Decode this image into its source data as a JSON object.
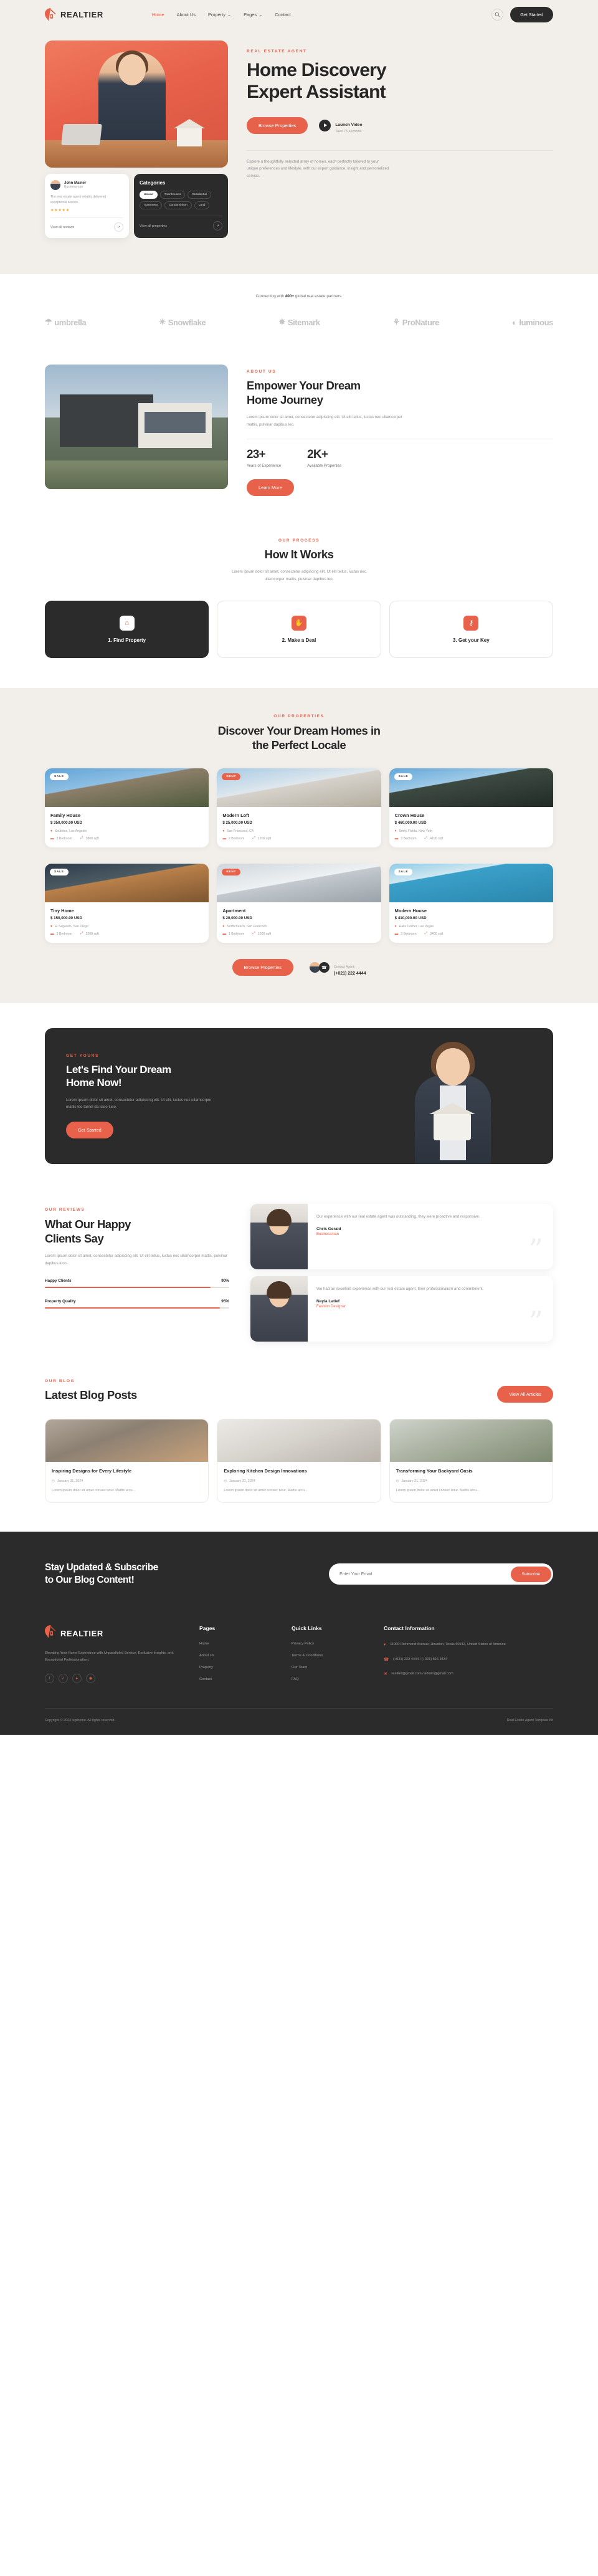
{
  "brand": {
    "name": "REALTIER",
    "accent": "#e8614a",
    "dark": "#2b2b2b"
  },
  "header": {
    "nav": [
      {
        "label": "Home",
        "active": true
      },
      {
        "label": "About Us",
        "active": false
      },
      {
        "label": "Property",
        "caret": "⌄",
        "active": false
      },
      {
        "label": "Pages",
        "caret": "⌄",
        "active": false
      },
      {
        "label": "Contact",
        "active": false
      }
    ],
    "search_icon": "⌕",
    "cta": "Get Started"
  },
  "hero": {
    "eyebrow": "REAL ESTATE AGENT",
    "title_line1": "Home Discovery",
    "title_line2": "Expert Assistant",
    "primary_btn": "Browse Properties",
    "video_title": "Launch Video",
    "video_sub": "Take 75 seconds",
    "description": "Explore a thoughtfully selected array of homes, each perfectly tailored to your unique preferences and lifestyle, with our expert guidance, insight and personalized service.",
    "review": {
      "name": "John Mainer",
      "role": "Businessman",
      "text": "The real estate agent reliably delivered exceptional service.",
      "stars": "★★★★★",
      "link": "View all reviews",
      "arrow": "↗"
    },
    "categories": {
      "title": "Categories",
      "chips": [
        "House",
        "Townhouses",
        "Residential",
        "Apartment",
        "Condominium",
        "Land"
      ],
      "active_chip": "House",
      "link": "View all properties",
      "arrow": "↗"
    }
  },
  "partners": {
    "caption_pre": "Connecting with ",
    "caption_bold": "400+",
    "caption_post": " global real estate partners.",
    "logos": [
      {
        "name": "umbrella",
        "glyph": "☂"
      },
      {
        "name": "Snowflake",
        "glyph": "✳"
      },
      {
        "name": "Sitemark",
        "glyph": "✵"
      },
      {
        "name": "ProNature",
        "glyph": "⚘"
      },
      {
        "name": "luminous",
        "glyph": "◐"
      }
    ]
  },
  "about": {
    "eyebrow": "ABOUT US",
    "title_line1": "Empower Your Dream",
    "title_line2": "Home Journey",
    "paragraph": "Lorem ipsum dolor sit amet, consectetur adipiscing elit. Ut elit tellus, luctus nec ullamcorper mattis, pulvinar dapibus leo.",
    "stats": [
      {
        "number": "23+",
        "label": "Years of Experience"
      },
      {
        "number": "2K+",
        "label": "Available Properties"
      }
    ],
    "btn": "Learn More"
  },
  "process": {
    "eyebrow": "OUR PROCESS",
    "title": "How It Works",
    "subtitle": "Lorem ipsum dolor sit amet, consectetur adipiscing elit. Ut elit tellus, luctus nec ullamcorper mattis, pulvinar dapibus leo.",
    "steps": [
      {
        "label": "1. Find Property",
        "icon": "⌂",
        "icon_name": "house-icon",
        "active": true
      },
      {
        "label": "2. Make a Deal",
        "icon": "✋",
        "icon_name": "handshake-icon",
        "active": false
      },
      {
        "label": "3. Get your Key",
        "icon": "⚷",
        "icon_name": "key-icon",
        "active": false
      }
    ]
  },
  "properties": {
    "eyebrow": "OUR PROPERTIES",
    "title_line1": "Discover Your Dream Homes in",
    "title_line2": "the Perfect Locale",
    "pin_icon": "▾",
    "bed_icon": "▬",
    "area_icon": "⤢",
    "items": [
      {
        "badge": "SALE",
        "badge_type": "sale",
        "name": "Family House",
        "price": "$ 350,000.00 USD",
        "location": "Southlea, Los Angeles",
        "bedrooms": "3 Bedroom",
        "area": "3800 sqft"
      },
      {
        "badge": "RENT",
        "badge_type": "rent",
        "name": "Modern Loft",
        "price": "$ 25,000.00 USD",
        "location": "San Francisco, CA",
        "bedrooms": "2 Bedroom",
        "area": "1200 sqft"
      },
      {
        "badge": "SALE",
        "badge_type": "sale",
        "name": "Crown House",
        "price": "$ 460,000.00 USD",
        "location": "Smity Fielda, New York",
        "bedrooms": "3 Bedroom",
        "area": "4100 sqft"
      },
      {
        "badge": "SALE",
        "badge_type": "sale",
        "name": "Tiny Home",
        "price": "$ 150,000.00 USD",
        "location": "El Segundo, San Diego",
        "bedrooms": "3 Bedroom",
        "area": "2200 sqft"
      },
      {
        "badge": "RENT",
        "badge_type": "rent",
        "name": "Apartment",
        "price": "$ 20,000.00 USD",
        "location": "North Beach, San Francisco",
        "bedrooms": "1 Bedroom",
        "area": "1000 sqft"
      },
      {
        "badge": "SALE",
        "badge_type": "sale",
        "name": "Modern House",
        "price": "$ 410,000.00 USD",
        "location": "Halls Corner, Las Vegas",
        "bedrooms": "3 Bedroom",
        "area": "3400 sqft"
      }
    ],
    "browse_btn": "Browse Properties",
    "contact_label": "Contact Agent:",
    "contact_phone": "(+021) 222 4444",
    "phone_icon": "☎"
  },
  "cta": {
    "eyebrow": "GET YOURS",
    "title_line1": "Let's Find Your Dream",
    "title_line2": "Home Now!",
    "paragraph": "Lorem ipsum dolor sit amet, consectetur adipiscing elit. Ut elit, luctus nec ullamcorper mattis leo tarnel da liaso luco.",
    "btn": "Get Started"
  },
  "reviews": {
    "eyebrow": "OUR REVIEWS",
    "title_line1": "What Our Happy",
    "title_line2": "Clients Say",
    "paragraph": "Lorem ipsum dolor sit amet, consectetur adipiscing elit. Ut elit tellus, luctus nec ullamcorper mattis, pulvinar dapibus luco.",
    "bars": [
      {
        "label": "Happy Clients",
        "value": "90%",
        "pct": 90
      },
      {
        "label": "Property Quality",
        "value": "95%",
        "pct": 95
      }
    ],
    "testimonials": [
      {
        "text": "Our experience with our real estate agent was outstanding, they were proactive and responsive.",
        "name": "Chris Gerald",
        "role": "Businessman",
        "quote": "”"
      },
      {
        "text": "We had an excellent experience with our real estate agent, their professionalism and commitment.",
        "name": "Nayla Latief",
        "role": "Fashion Designer",
        "quote": "”"
      }
    ]
  },
  "blog": {
    "eyebrow": "OUR BLOG",
    "title": "Latest Blog Posts",
    "view_all": "View All Articles",
    "clock_icon": "◴",
    "posts": [
      {
        "title": "Inspiring Designs for Every Lifestyle",
        "date": "January 31, 2024",
        "excerpt": "Lorem ipsum dolor sit amet consec tetur. Mattis arcu..."
      },
      {
        "title": "Exploring Kitchen Design Innovations",
        "date": "January 31, 2024",
        "excerpt": "Lorem ipsum dolor sit amet consec tetur. Mattis arcu..."
      },
      {
        "title": "Transforming Your Backyard Oasis",
        "date": "January 31, 2024",
        "excerpt": "Lorem ipsum dolor sit amet consec tetur. Mattis arcu..."
      }
    ]
  },
  "footer": {
    "subscribe_title_line1": "Stay Updated & Subscribe",
    "subscribe_title_line2": "to Our Blog Content!",
    "email_placeholder": "Enter Your Email",
    "email_value": "",
    "subscribe_btn": "Subscribe",
    "description": "Elevating Your Home Experience with Unparalleled Service, Exclusive Insights, and Exceptional Professionalism.",
    "socials": [
      {
        "name": "facebook-icon",
        "glyph": "f"
      },
      {
        "name": "twitter-icon",
        "glyph": "✓"
      },
      {
        "name": "youtube-icon",
        "glyph": "▸"
      },
      {
        "name": "instagram-icon",
        "glyph": "◉"
      }
    ],
    "pages": {
      "title": "Pages",
      "links": [
        "Home",
        "About Us",
        "Property",
        "Contact"
      ]
    },
    "quick": {
      "title": "Quick Links",
      "links": [
        "Privacy Policy",
        "Terms & Conditions",
        "Our Team",
        "FAQ"
      ]
    },
    "contact": {
      "title": "Contact Information",
      "items": [
        {
          "icon": "▾",
          "icon_name": "pin-icon",
          "text": "11900 Richmond Avenue, Houston, Texas 60142, United States of America"
        },
        {
          "icon": "☎",
          "icon_name": "phone-icon",
          "text": "(+021) 222 4444 / (+021) 515 3434"
        },
        {
          "icon": "✉",
          "icon_name": "mail-icon",
          "text": "realtier@gmail.com / admin@gmail.com"
        }
      ]
    },
    "copyright": "Copyright © 2024 iegtheme. All rights reserved.",
    "template": "Real Estate Agent Template Kit"
  }
}
